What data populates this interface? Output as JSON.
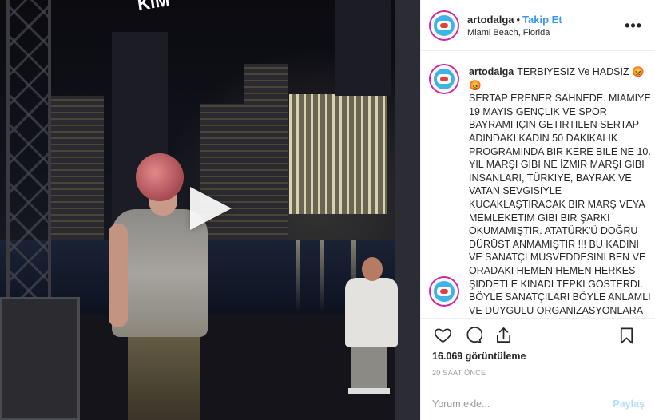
{
  "media": {
    "overlay_text": "KIM",
    "type": "video"
  },
  "post": {
    "username": "artodalga",
    "separator": "•",
    "follow_label": "Takip Et",
    "location": "Miami Beach, Florida",
    "more_label": "•••"
  },
  "caption": {
    "username": "artodalga",
    "text": "TERBIYESIZ Ve HADSIZ 😡\n😡\nSERTAP ERENER SAHNEDE. MIAMIYE 19 MAYIS GENÇLIK VE SPOR BAYRAMI IÇIN GETIRTILEN SERTAP ADINDAKI KADIN 50 DAKIKALIK PROGRAMINDA BIR KERE BILE NE 10. YIL MARŞI GIBI NE İZMIR MARŞI GIBI INSANLARI, TÜRKIYE, BAYRAK VE VATAN SEVGISIYLE KUCAKLAŞTIRACAK BIR MARŞ VEYA MEMLEKETIM GIBI BIR ŞARKI OKUMAMIŞTIR. ATATÜRK'Ü DOĞRU DÜRÜST ANMAMIŞTIR !!! BU KADINI VE SANATÇI MÜSVEDDESINI BEN VE ORADAKI HEMEN HEMEN HERKES ŞIDDETLE KINADI TEPKI GÖSTERDI. BÖYLE SANATÇILARI BÖYLE ANLAMLI VE DUYGULU ORGANIZASYONLARA ÜLKE DUYGULARINA VATAN"
  },
  "stats": {
    "views": "16.069 görüntüleme",
    "time_ago": "20 SAAT ÖNCE"
  },
  "comment": {
    "placeholder": "Yorum ekle...",
    "post_label": "Paylaş"
  },
  "colors": {
    "accent": "#3897f0",
    "post_disabled": "#b2dffc",
    "avatar_ring": "#d6249f"
  }
}
